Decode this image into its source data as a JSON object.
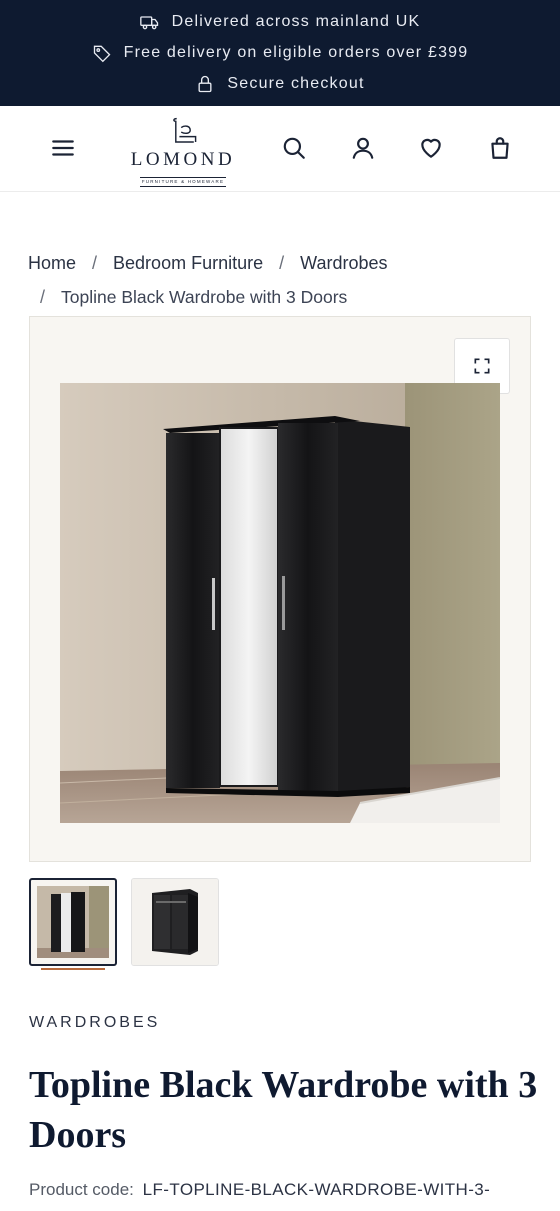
{
  "announcements": [
    {
      "icon": "truck-icon",
      "text": "Delivered across mainland UK"
    },
    {
      "icon": "tag-icon",
      "text": "Free delivery on eligible orders over £399"
    },
    {
      "icon": "lock-icon",
      "text": "Secure checkout"
    }
  ],
  "brand": {
    "name": "LOMOND",
    "tagline": "FURNITURE & HOMEWARE"
  },
  "header_icons": [
    "menu-icon",
    "search-icon",
    "account-icon",
    "wishlist-icon",
    "cart-icon"
  ],
  "breadcrumb": {
    "items": [
      "Home",
      "Bedroom Furniture",
      "Wardrobes"
    ],
    "separator": "/",
    "current": "Topline Black Wardrobe with 3 Doors"
  },
  "product": {
    "category": "WARDROBES",
    "title": "Topline Black Wardrobe with 3 Doors",
    "code_label": "Product code:",
    "code_value": "LF-TOPLINE-BLACK-WARDROBE-WITH-3-"
  },
  "colors": {
    "announcement_bg": "#0e1a30",
    "text_dark": "#0f1a30",
    "active_thumb_border": "#1b2335",
    "thumb_underline": "#b86a3c"
  }
}
